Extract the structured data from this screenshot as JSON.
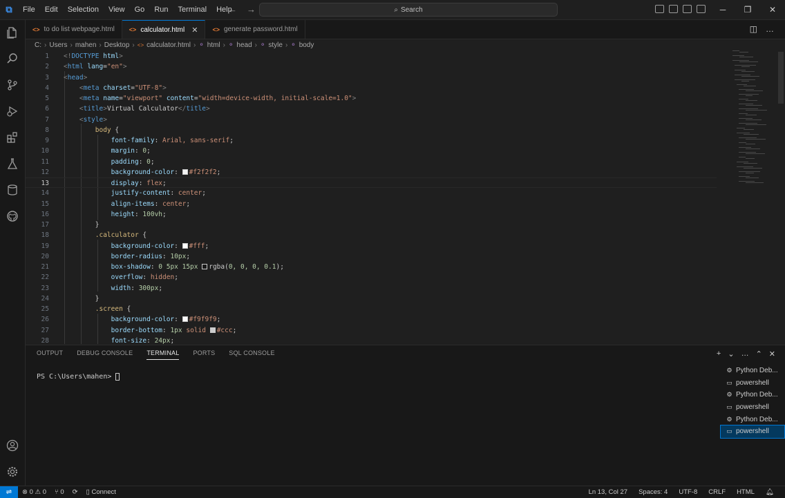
{
  "menu": [
    "File",
    "Edit",
    "Selection",
    "View",
    "Go",
    "Run",
    "Terminal",
    "Help"
  ],
  "search": {
    "label": "Search"
  },
  "tabs": [
    {
      "label": "to do list webpage.html",
      "active": false
    },
    {
      "label": "calculator.html",
      "active": true
    },
    {
      "label": "generate password.html",
      "active": false
    }
  ],
  "breadcrumb": [
    "C:",
    "Users",
    "mahen",
    "Desktop",
    "calculator.html",
    "html",
    "head",
    "style",
    "body"
  ],
  "editor": {
    "current_line": 13,
    "lines": [
      {
        "n": "1",
        "indent": 0,
        "tokens": [
          [
            "pun",
            "<!"
          ],
          [
            "tag",
            "DOCTYPE"
          ],
          [
            "txt",
            " "
          ],
          [
            "att",
            "html"
          ],
          [
            "pun",
            ">"
          ]
        ]
      },
      {
        "n": "2",
        "indent": 0,
        "tokens": [
          [
            "pun",
            "<"
          ],
          [
            "tag",
            "html"
          ],
          [
            "txt",
            " "
          ],
          [
            "att",
            "lang"
          ],
          [
            "txt",
            "="
          ],
          [
            "str",
            "\"en\""
          ],
          [
            "pun",
            ">"
          ]
        ]
      },
      {
        "n": "3",
        "indent": 0,
        "tokens": [
          [
            "pun",
            "<"
          ],
          [
            "tag",
            "head"
          ],
          [
            "pun",
            ">"
          ]
        ]
      },
      {
        "n": "4",
        "indent": 1,
        "tokens": [
          [
            "pun",
            "<"
          ],
          [
            "tag",
            "meta"
          ],
          [
            "txt",
            " "
          ],
          [
            "att",
            "charset"
          ],
          [
            "txt",
            "="
          ],
          [
            "str",
            "\"UTF-8\""
          ],
          [
            "pun",
            ">"
          ]
        ]
      },
      {
        "n": "5",
        "indent": 1,
        "tokens": [
          [
            "pun",
            "<"
          ],
          [
            "tag",
            "meta"
          ],
          [
            "txt",
            " "
          ],
          [
            "att",
            "name"
          ],
          [
            "txt",
            "="
          ],
          [
            "str",
            "\"viewport\""
          ],
          [
            "txt",
            " "
          ],
          [
            "att",
            "content"
          ],
          [
            "txt",
            "="
          ],
          [
            "str",
            "\"width=device-width, initial-scale=1.0\""
          ],
          [
            "pun",
            ">"
          ]
        ]
      },
      {
        "n": "6",
        "indent": 1,
        "tokens": [
          [
            "pun",
            "<"
          ],
          [
            "tag",
            "title"
          ],
          [
            "pun",
            ">"
          ],
          [
            "txt",
            "Virtual Calculator"
          ],
          [
            "pun",
            "</"
          ],
          [
            "tag",
            "title"
          ],
          [
            "pun",
            ">"
          ]
        ]
      },
      {
        "n": "7",
        "indent": 1,
        "tokens": [
          [
            "pun",
            "<"
          ],
          [
            "tag",
            "style"
          ],
          [
            "pun",
            ">"
          ]
        ]
      },
      {
        "n": "8",
        "indent": 2,
        "tokens": [
          [
            "sel",
            "body"
          ],
          [
            "txt",
            " {"
          ]
        ]
      },
      {
        "n": "9",
        "indent": 3,
        "tokens": [
          [
            "prop",
            "font-family"
          ],
          [
            "txt",
            ": "
          ],
          [
            "val",
            "Arial, sans-serif"
          ],
          [
            "txt",
            ";"
          ]
        ]
      },
      {
        "n": "10",
        "indent": 3,
        "tokens": [
          [
            "prop",
            "margin"
          ],
          [
            "txt",
            ": "
          ],
          [
            "num",
            "0"
          ],
          [
            "txt",
            ";"
          ]
        ]
      },
      {
        "n": "11",
        "indent": 3,
        "tokens": [
          [
            "prop",
            "padding"
          ],
          [
            "txt",
            ": "
          ],
          [
            "num",
            "0"
          ],
          [
            "txt",
            ";"
          ]
        ]
      },
      {
        "n": "12",
        "indent": 3,
        "tokens": [
          [
            "prop",
            "background-color"
          ],
          [
            "txt",
            ": "
          ],
          [
            "sw",
            "#f2f2f2"
          ],
          [
            "val",
            "#f2f2f2"
          ],
          [
            "txt",
            ";"
          ]
        ]
      },
      {
        "n": "13",
        "indent": 3,
        "tokens": [
          [
            "prop",
            "display"
          ],
          [
            "txt",
            ": "
          ],
          [
            "val",
            "flex"
          ],
          [
            "txt",
            ";"
          ]
        ]
      },
      {
        "n": "14",
        "indent": 3,
        "tokens": [
          [
            "prop",
            "justify-content"
          ],
          [
            "txt",
            ": "
          ],
          [
            "val",
            "center"
          ],
          [
            "txt",
            ";"
          ]
        ]
      },
      {
        "n": "15",
        "indent": 3,
        "tokens": [
          [
            "prop",
            "align-items"
          ],
          [
            "txt",
            ": "
          ],
          [
            "val",
            "center"
          ],
          [
            "txt",
            ";"
          ]
        ]
      },
      {
        "n": "16",
        "indent": 3,
        "tokens": [
          [
            "prop",
            "height"
          ],
          [
            "txt",
            ": "
          ],
          [
            "num",
            "100vh"
          ],
          [
            "txt",
            ";"
          ]
        ]
      },
      {
        "n": "17",
        "indent": 2,
        "tokens": [
          [
            "txt",
            "}"
          ]
        ]
      },
      {
        "n": "18",
        "indent": 2,
        "tokens": [
          [
            "sel",
            ".calculator"
          ],
          [
            "txt",
            " {"
          ]
        ]
      },
      {
        "n": "19",
        "indent": 3,
        "tokens": [
          [
            "prop",
            "background-color"
          ],
          [
            "txt",
            ": "
          ],
          [
            "sw",
            "#ffffff"
          ],
          [
            "val",
            "#fff"
          ],
          [
            "txt",
            ";"
          ]
        ]
      },
      {
        "n": "20",
        "indent": 3,
        "tokens": [
          [
            "prop",
            "border-radius"
          ],
          [
            "txt",
            ": "
          ],
          [
            "num",
            "10px"
          ],
          [
            "txt",
            ";"
          ]
        ]
      },
      {
        "n": "21",
        "indent": 3,
        "tokens": [
          [
            "prop",
            "box-shadow"
          ],
          [
            "txt",
            ": "
          ],
          [
            "num",
            "0 5px 15px "
          ],
          [
            "sw",
            "#1a1a1a"
          ],
          [
            "txt",
            "rgba("
          ],
          [
            "num",
            "0, 0, 0, 0.1"
          ],
          [
            "txt",
            ");"
          ]
        ]
      },
      {
        "n": "22",
        "indent": 3,
        "tokens": [
          [
            "prop",
            "overflow"
          ],
          [
            "txt",
            ": "
          ],
          [
            "val",
            "hidden"
          ],
          [
            "txt",
            ";"
          ]
        ]
      },
      {
        "n": "23",
        "indent": 3,
        "tokens": [
          [
            "prop",
            "width"
          ],
          [
            "txt",
            ": "
          ],
          [
            "num",
            "300px"
          ],
          [
            "txt",
            ";"
          ]
        ]
      },
      {
        "n": "24",
        "indent": 2,
        "tokens": [
          [
            "txt",
            "}"
          ]
        ]
      },
      {
        "n": "25",
        "indent": 2,
        "tokens": [
          [
            "sel",
            ".screen"
          ],
          [
            "txt",
            " {"
          ]
        ]
      },
      {
        "n": "26",
        "indent": 3,
        "tokens": [
          [
            "prop",
            "background-color"
          ],
          [
            "txt",
            ": "
          ],
          [
            "sw",
            "#f9f9f9"
          ],
          [
            "val",
            "#f9f9f9"
          ],
          [
            "txt",
            ";"
          ]
        ]
      },
      {
        "n": "27",
        "indent": 3,
        "tokens": [
          [
            "prop",
            "border-bottom"
          ],
          [
            "txt",
            ": "
          ],
          [
            "num",
            "1px"
          ],
          [
            "txt",
            " "
          ],
          [
            "val",
            "solid"
          ],
          [
            "txt",
            " "
          ],
          [
            "sw",
            "#cccccc"
          ],
          [
            "val",
            "#ccc"
          ],
          [
            "txt",
            ";"
          ]
        ]
      },
      {
        "n": "28",
        "indent": 3,
        "tokens": [
          [
            "prop",
            "font-size"
          ],
          [
            "txt",
            ": "
          ],
          [
            "num",
            "24px"
          ],
          [
            "txt",
            ";"
          ]
        ]
      }
    ]
  },
  "panel": {
    "tabs": [
      {
        "label": "OUTPUT",
        "active": false
      },
      {
        "label": "DEBUG CONSOLE",
        "active": false
      },
      {
        "label": "TERMINAL",
        "active": true
      },
      {
        "label": "PORTS",
        "active": false
      },
      {
        "label": "SQL CONSOLE",
        "active": false
      }
    ],
    "prompt": "PS C:\\Users\\mahen>",
    "terminals": [
      {
        "label": "Python Deb...",
        "type": "debug",
        "active": false
      },
      {
        "label": "powershell",
        "type": "shell",
        "active": false
      },
      {
        "label": "Python Deb...",
        "type": "debug",
        "active": false
      },
      {
        "label": "powershell",
        "type": "shell",
        "active": false
      },
      {
        "label": "Python Deb...",
        "type": "debug",
        "active": false
      },
      {
        "label": "powershell",
        "type": "shell",
        "active": true
      }
    ]
  },
  "status": {
    "errors": "0",
    "warnings": "0",
    "ports": "0",
    "connect": "Connect",
    "position": "Ln 13, Col 27",
    "spaces": "Spaces: 4",
    "encoding": "UTF-8",
    "eol": "CRLF",
    "language": "HTML"
  },
  "colors": {
    "accent": "#0078d4",
    "html_icon": "#e37933"
  }
}
